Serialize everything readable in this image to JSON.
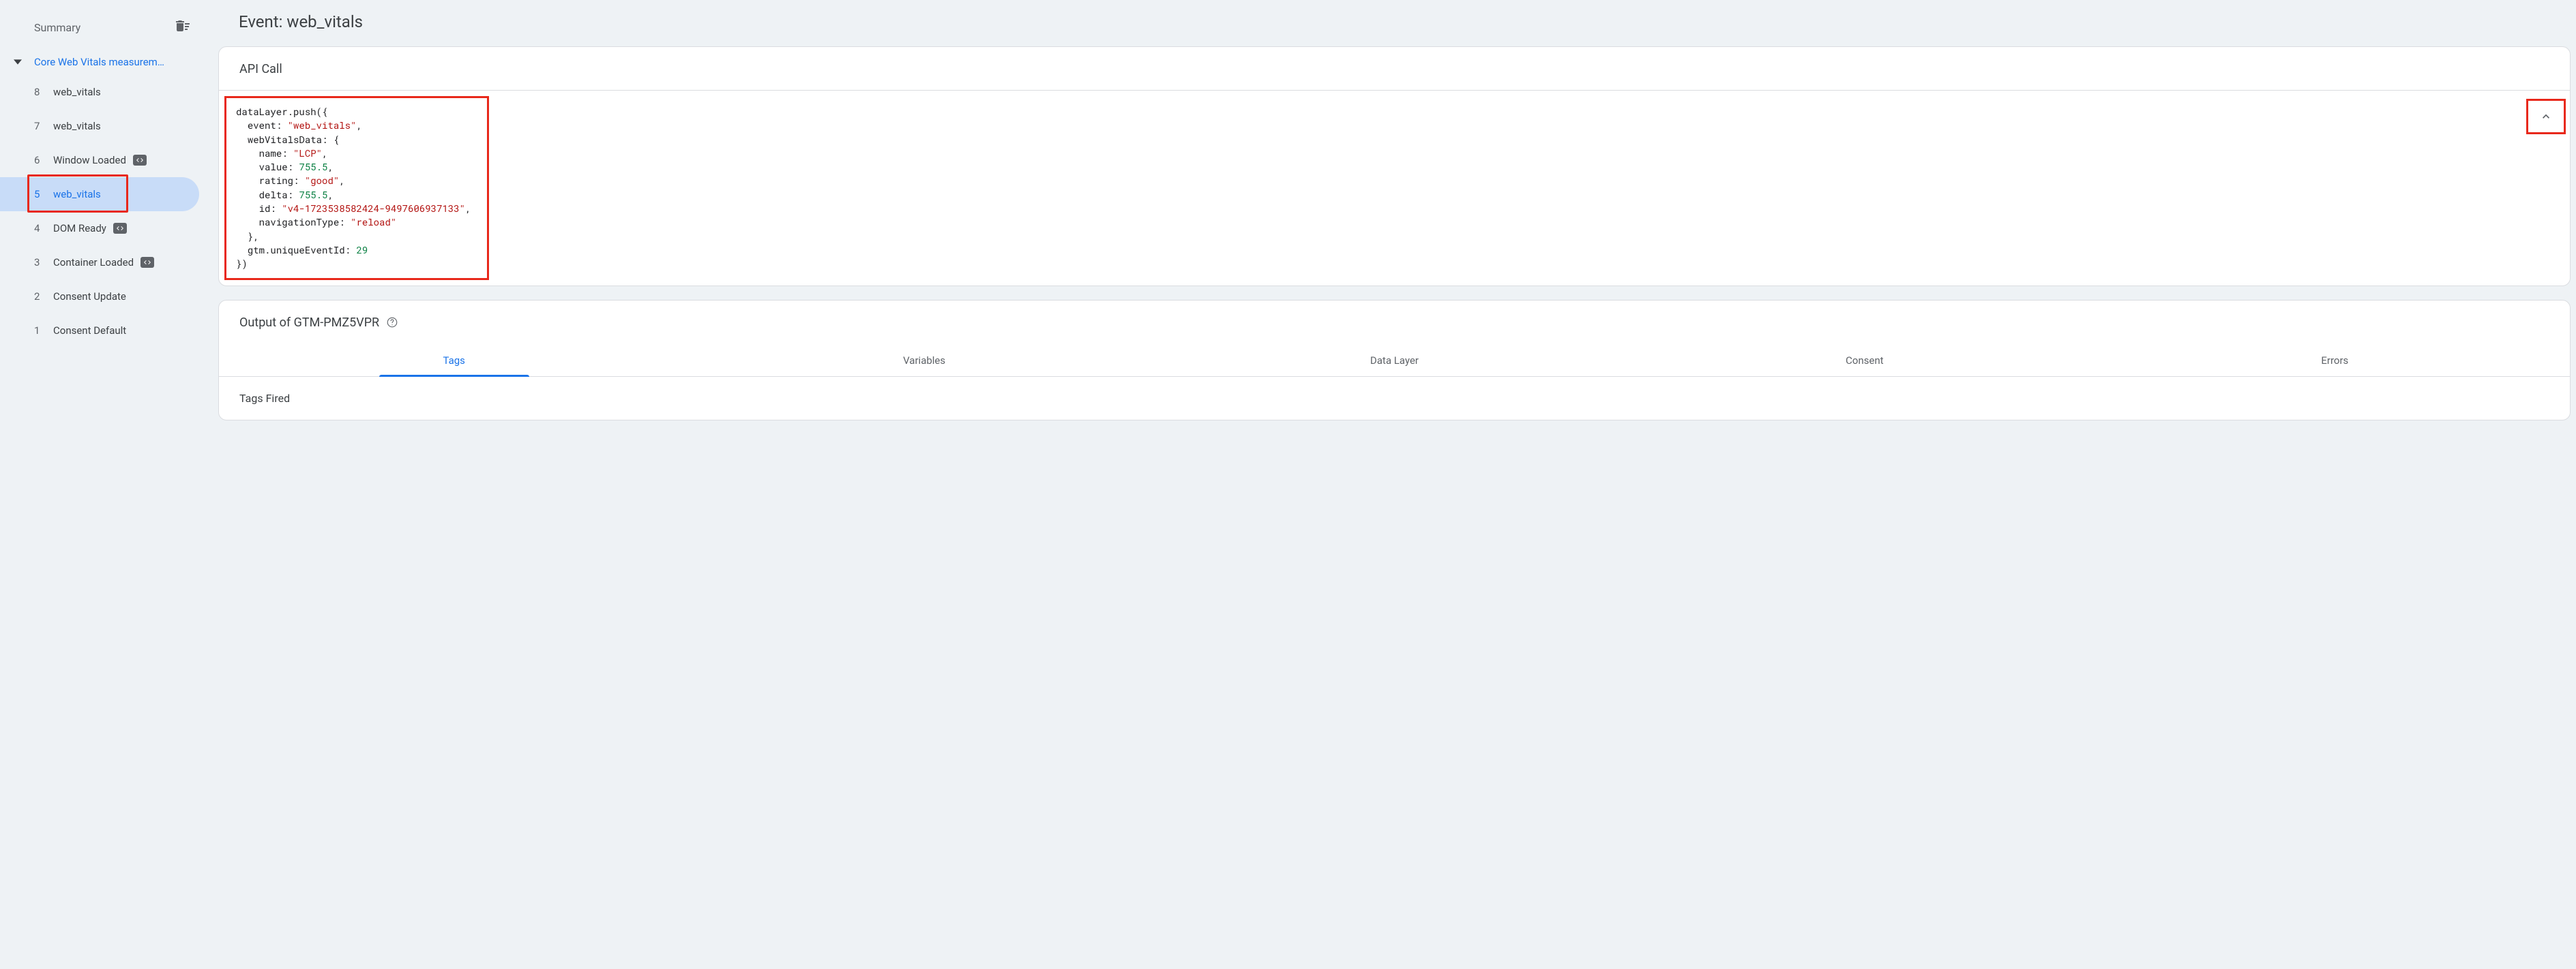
{
  "sidebar": {
    "title": "Summary",
    "group_label": "Core Web Vitals measurem…",
    "events": [
      {
        "num": "8",
        "label": "web_vitals",
        "has_code_badge": false,
        "selected": false
      },
      {
        "num": "7",
        "label": "web_vitals",
        "has_code_badge": false,
        "selected": false
      },
      {
        "num": "6",
        "label": "Window Loaded",
        "has_code_badge": true,
        "selected": false
      },
      {
        "num": "5",
        "label": "web_vitals",
        "has_code_badge": false,
        "selected": true
      },
      {
        "num": "4",
        "label": "DOM Ready",
        "has_code_badge": true,
        "selected": false
      },
      {
        "num": "3",
        "label": "Container Loaded",
        "has_code_badge": true,
        "selected": false
      },
      {
        "num": "2",
        "label": "Consent Update",
        "has_code_badge": false,
        "selected": false
      },
      {
        "num": "1",
        "label": "Consent Default",
        "has_code_badge": false,
        "selected": false
      }
    ]
  },
  "page_title": "Event: web_vitals",
  "api_card": {
    "header": "API Call",
    "code": {
      "prefix": "dataLayer.push({",
      "event_key": "event",
      "event_val": "\"web_vitals\"",
      "wvd_key": "webVitalsData",
      "name_key": "name",
      "name_val": "\"LCP\"",
      "value_key": "value",
      "value_val": "755.5",
      "rating_key": "rating",
      "rating_val": "\"good\"",
      "delta_key": "delta",
      "delta_val": "755.5",
      "id_key": "id",
      "id_val": "\"v4-1723538582424-9497606937133\"",
      "nav_key": "navigationType",
      "nav_val": "\"reload\"",
      "gtm_key": "gtm.uniqueEventId",
      "gtm_val": "29",
      "suffix": "})"
    }
  },
  "output_card": {
    "header": "Output of GTM-PMZ5VPR",
    "tabs": [
      "Tags",
      "Variables",
      "Data Layer",
      "Consent",
      "Errors"
    ],
    "body": "Tags Fired"
  }
}
